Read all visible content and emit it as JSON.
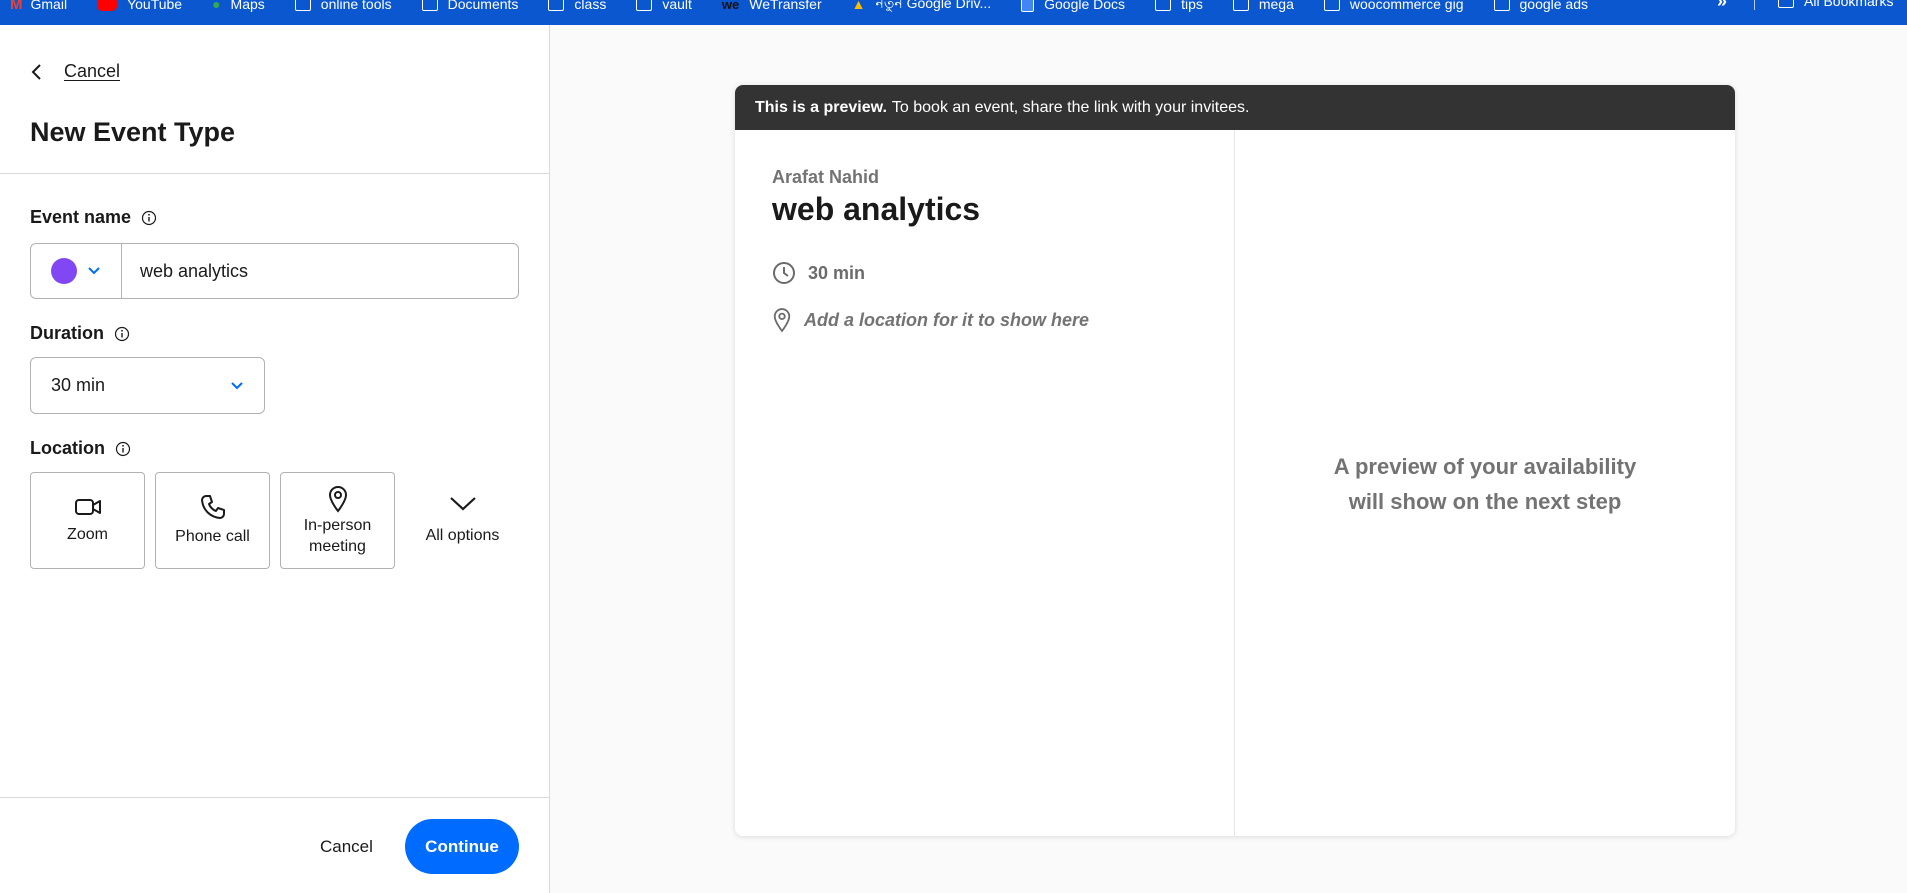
{
  "bookmarks": {
    "items": [
      {
        "label": "Gmail"
      },
      {
        "label": "YouTube"
      },
      {
        "label": "Maps"
      },
      {
        "label": "online tools"
      },
      {
        "label": "Documents"
      },
      {
        "label": "class"
      },
      {
        "label": "vault"
      },
      {
        "label": "WeTransfer"
      },
      {
        "label": "নতুন Google Driv..."
      },
      {
        "label": "Google Docs"
      },
      {
        "label": "tips"
      },
      {
        "label": "mega"
      },
      {
        "label": "woocommerce gig"
      },
      {
        "label": "google ads"
      }
    ],
    "more_label": "»",
    "all_bookmarks": "All Bookmarks"
  },
  "form": {
    "back_label": "Cancel",
    "title": "New Event Type",
    "event_name_label": "Event name",
    "event_name_value": "web analytics",
    "event_color": "#8247f5",
    "duration_label": "Duration",
    "duration_value": "30 min",
    "location_label": "Location",
    "location_options": [
      {
        "label": "Zoom",
        "icon": "video-camera-icon"
      },
      {
        "label": "Phone call",
        "icon": "phone-icon"
      },
      {
        "label": "In-person meeting",
        "icon": "map-pin-icon"
      },
      {
        "label": "All options",
        "icon": "chevron-down-icon"
      }
    ],
    "cancel_label": "Cancel",
    "continue_label": "Continue"
  },
  "preview": {
    "banner_bold": "This is a preview.",
    "banner_text": "To book an event, share the link with your invitees.",
    "host_name": "Arafat Nahid",
    "event_title": "web analytics",
    "duration": "30 min",
    "location_placeholder": "Add a location for it to show here",
    "availability_line1": "A preview of your availability",
    "availability_line2": "will show on the next step"
  },
  "colors": {
    "accent": "#006bff",
    "bookmark_bar": "#0b57d0",
    "banner": "#333333"
  }
}
